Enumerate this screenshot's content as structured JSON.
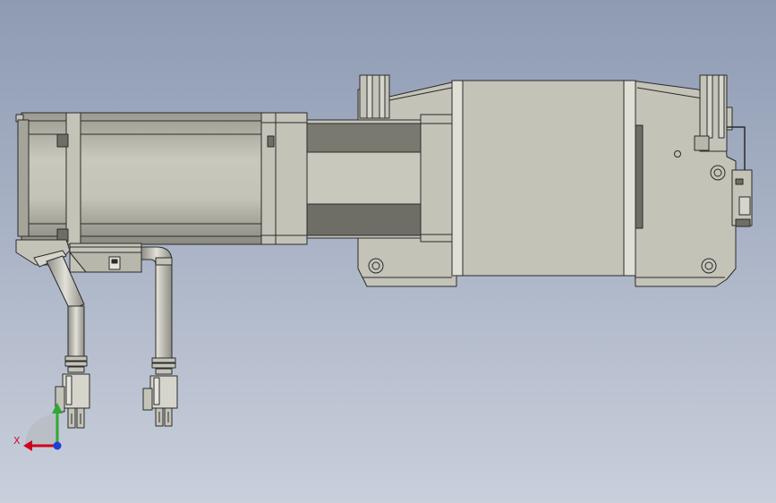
{
  "colors": {
    "bg_top": "#8e9bb3",
    "bg_bottom": "#c9cfdb",
    "part_fill": "#c4c3b8",
    "part_light": "#d6d5cc",
    "part_dark": "#6e6d66",
    "edge": "#2b2b2b",
    "axis_x": "#d0021b",
    "axis_y": "#2ea836",
    "axis_z": "#1d3fd6"
  },
  "triad": {
    "x_label": "X"
  }
}
